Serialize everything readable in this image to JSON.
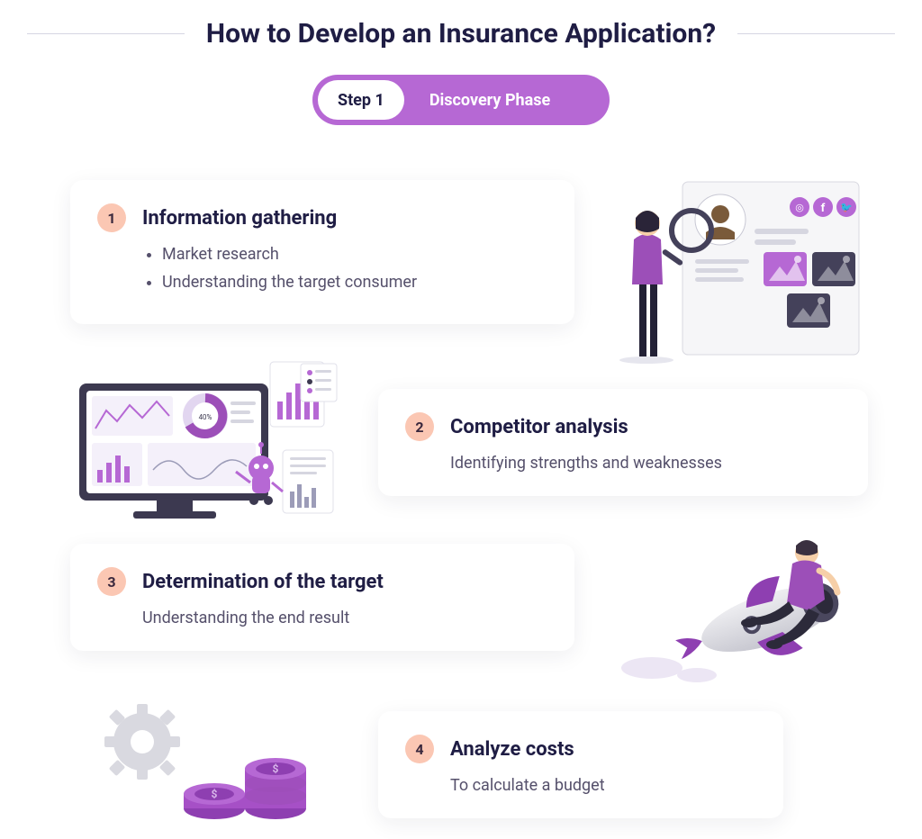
{
  "header": {
    "title": "How to Develop an Insurance Application?"
  },
  "step_pill": {
    "chip": "Step 1",
    "phase": "Discovery Phase"
  },
  "colors": {
    "accent": "#b668d4",
    "badge": "#fbc7b3",
    "dark": "#1f1d44",
    "muted": "#55506b"
  },
  "cards": [
    {
      "num": "1",
      "title": "Information gathering",
      "bullets": [
        "Market research",
        "Understanding the target consumer"
      ]
    },
    {
      "num": "2",
      "title": "Competitor analysis",
      "desc": "Identifying strengths and weaknesses"
    },
    {
      "num": "3",
      "title": "Determination of the target",
      "desc": "Understanding the end result"
    },
    {
      "num": "4",
      "title": "Analyze costs",
      "desc": "To calculate a budget"
    }
  ],
  "illustrations": {
    "research": "woman-magnifying-glass-social-profile",
    "monitor": "dashboard-analytics-robot",
    "rocket": "man-riding-rocket",
    "coins": "gear-and-coin-stacks"
  }
}
